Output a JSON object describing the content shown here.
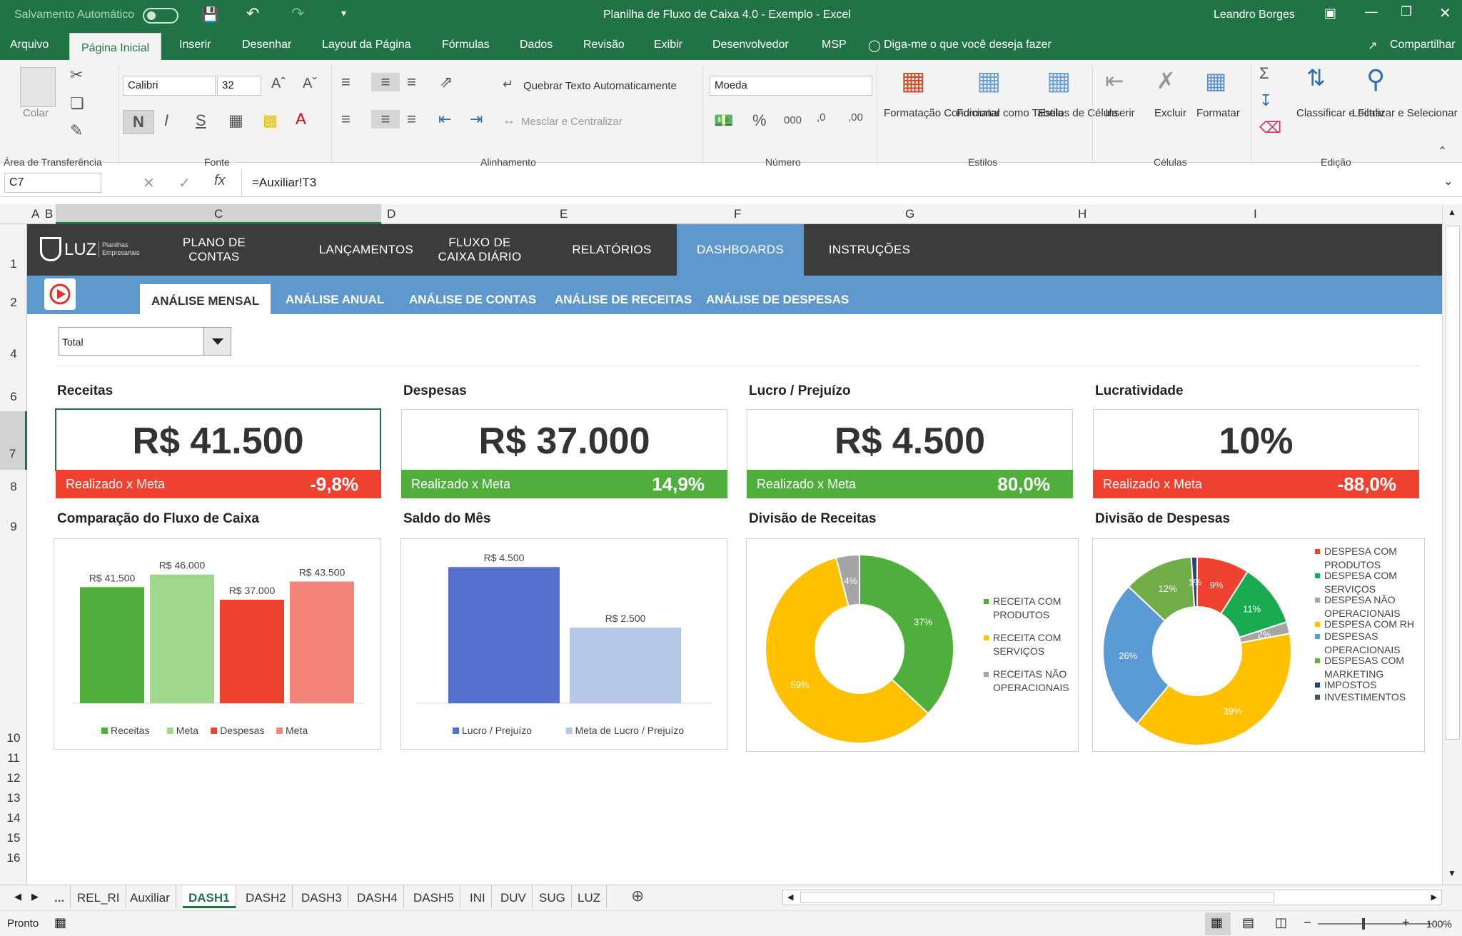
{
  "titlebar": {
    "autosave": "Salvamento Automático",
    "title": "Planilha de Fluxo de Caixa 4.0 - Exemplo  -  Excel",
    "user": "Leandro Borges"
  },
  "ribbon_tabs": [
    "Arquivo",
    "Página Inicial",
    "Inserir",
    "Desenhar",
    "Layout da Página",
    "Fórmulas",
    "Dados",
    "Revisão",
    "Exibir",
    "Desenvolvedor",
    "MSP"
  ],
  "tell_me": "Diga-me o que você deseja fazer",
  "share": "Compartilhar",
  "ribbon": {
    "paste": "Colar",
    "font_name": "Calibri",
    "font_size": "32",
    "bold": "N",
    "italic": "I",
    "underline": "S",
    "wrap": "Quebrar Texto Automaticamente",
    "merge": "Mesclar e Centralizar",
    "number_format": "Moeda",
    "cond_format": "Formatação Condicional",
    "format_table": "Formatar como Tabela",
    "cell_styles": "Estilos de Célula",
    "insert": "Inserir",
    "delete": "Excluir",
    "format": "Formatar",
    "sort": "Classificar e Filtrar",
    "find": "Localizar e Selecionar",
    "groups": {
      "clipboard": "Área de Transferência",
      "font": "Fonte",
      "alignment": "Alinhamento",
      "number": "Número",
      "styles": "Estilos",
      "cells": "Células",
      "editing": "Edição"
    }
  },
  "formula_bar": {
    "name_box": "C7",
    "formula": "=Auxiliar!T3"
  },
  "columns": [
    "A",
    "B",
    "C",
    "D",
    "E",
    "F",
    "G",
    "H",
    "I"
  ],
  "rows": [
    "1",
    "2",
    "4",
    "6",
    "7",
    "8",
    "9",
    "10",
    "11",
    "12",
    "13",
    "14",
    "15",
    "16"
  ],
  "dashboard": {
    "logo": "LUZ",
    "logo_sub": "Planilhas Empresariais",
    "nav": [
      {
        "label": "PLANO DE CONTAS"
      },
      {
        "label": "LANÇAMENTOS"
      },
      {
        "label": "FLUXO DE CAIXA DIÁRIO"
      },
      {
        "label": "RELATÓRIOS"
      },
      {
        "label": "DASHBOARDS"
      },
      {
        "label": "INSTRUÇÕES"
      }
    ],
    "subnav": [
      "ANÁLISE MENSAL",
      "ANÁLISE ANUAL",
      "ANÁLISE DE CONTAS",
      "ANÁLISE DE RECEITAS",
      "ANÁLISE DE DESPESAS"
    ],
    "filter_value": "Total",
    "kpis": [
      {
        "title": "Receitas",
        "value": "R$ 41.500",
        "label": "Realizado x Meta",
        "delta": "-9,8%",
        "color": "#ef4130"
      },
      {
        "title": "Despesas",
        "value": "R$ 37.000",
        "label": "Realizado x Meta",
        "delta": "14,9%",
        "color": "#4fae3c"
      },
      {
        "title": "Lucro / Prejuízo",
        "value": "R$ 4.500",
        "label": "Realizado x Meta",
        "delta": "80,0%",
        "color": "#4fae3c"
      },
      {
        "title": "Lucratividade",
        "value": "10%",
        "label": "Realizado x Meta",
        "delta": "-88,0%",
        "color": "#ef4130"
      }
    ],
    "chart_titles": [
      "Comparação do Fluxo de Caixa",
      "Saldo do Mês",
      "Divisão de Receitas",
      "Divisão de Despesas"
    ]
  },
  "chart_data": [
    {
      "type": "bar",
      "title": "Comparação do Fluxo de Caixa",
      "categories": [
        "Receitas",
        "Meta",
        "Despesas",
        "Meta"
      ],
      "values": [
        41500,
        46000,
        37000,
        43500
      ],
      "labels": [
        "R$ 41.500",
        "R$ 46.000",
        "R$ 37.000",
        "R$ 43.500"
      ],
      "colors": [
        "#4fae3c",
        "#9fd88c",
        "#ef4130",
        "#f4857a"
      ],
      "ylim": [
        0,
        50000
      ],
      "grid": false,
      "legend": "bottom"
    },
    {
      "type": "bar",
      "title": "Saldo do Mês",
      "categories": [
        "Lucro / Prejuízo",
        "Meta de Lucro / Prejuízo"
      ],
      "values": [
        4500,
        2500
      ],
      "labels": [
        "R$ 4.500",
        "R$ 2.500"
      ],
      "colors": [
        "#5470cc",
        "#b4c7e7"
      ],
      "ylim": [
        0,
        5000
      ],
      "grid": false,
      "legend": "bottom"
    },
    {
      "type": "pie",
      "title": "Divisão de Receitas",
      "series": [
        {
          "name": "RECEITA COM PRODUTOS",
          "value": 37,
          "label": "37%",
          "color": "#4fae3c"
        },
        {
          "name": "RECEITA COM SERVIÇOS",
          "value": 59,
          "label": "59%",
          "color": "#ffc000"
        },
        {
          "name": "RECEITAS NÃO OPERACIONAIS",
          "value": 4,
          "label": "4%",
          "color": "#a5a5a5"
        }
      ],
      "legend": "right"
    },
    {
      "type": "pie",
      "title": "Divisão de Despesas",
      "series": [
        {
          "name": "DESPESA COM PRODUTOS",
          "value": 9,
          "label": "9%",
          "color": "#ef4130"
        },
        {
          "name": "DESPESA COM SERVIÇOS",
          "value": 11,
          "label": "11%",
          "color": "#1aaa50"
        },
        {
          "name": "DESPESA NÃO OPERACIONAIS",
          "value": 2,
          "label": "2%",
          "color": "#a5a5a5"
        },
        {
          "name": "DESPESA COM RH",
          "value": 39,
          "label": "39%",
          "color": "#ffc000"
        },
        {
          "name": "DESPESAS OPERACIONAIS",
          "value": 26,
          "label": "26%",
          "color": "#5b9bd5"
        },
        {
          "name": "DESPESAS COM MARKETING",
          "value": 12,
          "label": "12%",
          "color": "#70ad47"
        },
        {
          "name": "IMPOSTOS",
          "value": 1,
          "label": "1%",
          "color": "#264478"
        },
        {
          "name": "INVESTIMENTOS",
          "value": 0,
          "label": "0%",
          "color": "#44546a"
        }
      ],
      "legend": "right"
    }
  ],
  "sheets": [
    "...",
    "REL_RI",
    "Auxiliar",
    "DASH1",
    "DASH2",
    "DASH3",
    "DASH4",
    "DASH5",
    "INI",
    "DUV",
    "SUG",
    "LUZ"
  ],
  "active_sheet": "DASH1",
  "status": {
    "ready": "Pronto",
    "zoom": "100%"
  }
}
